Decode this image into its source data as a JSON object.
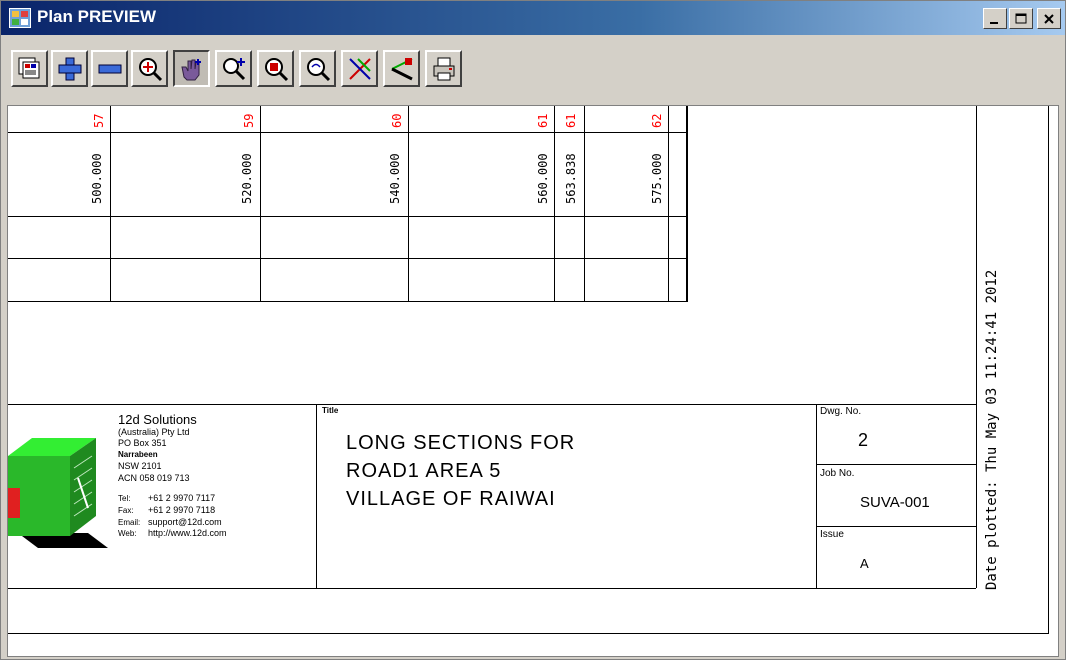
{
  "window": {
    "title": "Plan PREVIEW",
    "controls": {
      "minimize": "_",
      "maximize": "□",
      "close": "✕"
    }
  },
  "toolbar": {
    "buttons": [
      {
        "name": "plot-settings",
        "icon": "layers-icon"
      },
      {
        "name": "zoom-in-plus",
        "icon": "plus-icon"
      },
      {
        "name": "zoom-out-minus",
        "icon": "minus-icon"
      },
      {
        "name": "zoom-extent",
        "icon": "zoom-target-icon"
      },
      {
        "name": "pan",
        "icon": "hand-pan-icon",
        "pressed": true
      },
      {
        "name": "zoom-in",
        "icon": "zoom-plus-icon"
      },
      {
        "name": "zoom-window",
        "icon": "zoom-region-icon"
      },
      {
        "name": "zoom-fit",
        "icon": "magnifier-icon"
      },
      {
        "name": "measure",
        "icon": "measure-icon"
      },
      {
        "name": "pick",
        "icon": "pick-icon"
      },
      {
        "name": "print",
        "icon": "printer-icon"
      }
    ]
  },
  "section_table": {
    "chainage_labels": [
      "57",
      "59",
      "60",
      "61",
      "61",
      "62"
    ],
    "chainage_values": [
      "500.000",
      "520.000",
      "540.000",
      "560.000",
      "563.838",
      "575.000"
    ],
    "label_color": "#ff0000"
  },
  "title_block": {
    "company": {
      "name": "12d Solutions",
      "line1": "(Australia) Pty Ltd",
      "line2": "PO Box 351",
      "line3": "Narrabeen",
      "line4": "NSW 2101",
      "line5": "ACN 058 019 713",
      "tel_label": "Tel:",
      "tel": "+61 2 9970 7117",
      "fax_label": "Fax:",
      "fax": "+61 2 9970 7118",
      "email_label": "Email:",
      "email": "support@12d.com",
      "web_label": "Web:",
      "web": "http://www.12d.com"
    },
    "title_label": "Title",
    "title_lines": [
      "LONG SECTIONS FOR",
      "ROAD1 AREA 5",
      "VILLAGE OF RAIWAI"
    ],
    "dwg_label": "Dwg. No.",
    "dwg_value": "2",
    "job_label": "Job No.",
    "job_value": "SUVA-001",
    "issue_label": "Issue",
    "issue_value": "A",
    "date_plotted": "Date plotted:   Thu May 03 11:24:41 2012"
  }
}
